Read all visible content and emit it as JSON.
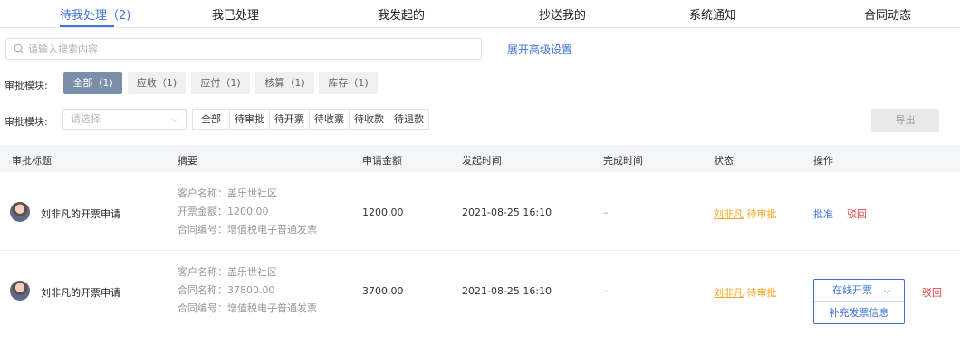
{
  "tabs": [
    {
      "label": "待我处理（2)"
    },
    {
      "label": "我已处理"
    },
    {
      "label": "我发起的"
    },
    {
      "label": "抄送我的"
    },
    {
      "label": "系统通知"
    },
    {
      "label": "合同动态"
    }
  ],
  "search": {
    "placeholder": "请输入搜索内容",
    "value": ""
  },
  "advanced_label": "展开高级设置",
  "module_filter": {
    "label": "审批模块:",
    "options": [
      "全部（1)",
      "应收（1)",
      "应付（1)",
      "核算（1)",
      "库存（1)"
    ],
    "selected": "全部（1)"
  },
  "status_filter": {
    "label": "审批模块:",
    "select_placeholder": "请选择",
    "options": [
      "全部",
      "待审批",
      "待开票",
      "待收票",
      "待收款",
      "待退款"
    ]
  },
  "export_label": "导出",
  "table": {
    "headers": [
      "审批标题",
      "摘要",
      "申请金额",
      "发起时间",
      "完成时间",
      "状态",
      "操作"
    ],
    "rows": [
      {
        "title": "刘非凡的开票申请",
        "summary": [
          "客户名称：盖乐世社区",
          "开票金额：1200.00",
          "合同编号：增值税电子普通发票"
        ],
        "amount": "1200.00",
        "start_time": "2021-08-25 16:10",
        "end_time": "–",
        "status_user": "刘非凡",
        "status_text": "待审批",
        "actions": [
          "批准",
          "驳回"
        ]
      },
      {
        "title": "刘非凡的开票申请",
        "summary": [
          "客户名称：盖乐世社区",
          "合同名称：37800.00",
          "合同编号：增值税电子普通发票"
        ],
        "amount": "3700.00",
        "start_time": "2021-08-25 16:10",
        "end_time": "–",
        "status_user": "刘非凡",
        "status_text": "待审批",
        "actions": [
          "在线开票",
          "补充发票信息",
          "驳回"
        ]
      }
    ]
  },
  "colors": {
    "accent": "#3f72d8",
    "warning": "#f5a623",
    "danger": "#e04848"
  }
}
